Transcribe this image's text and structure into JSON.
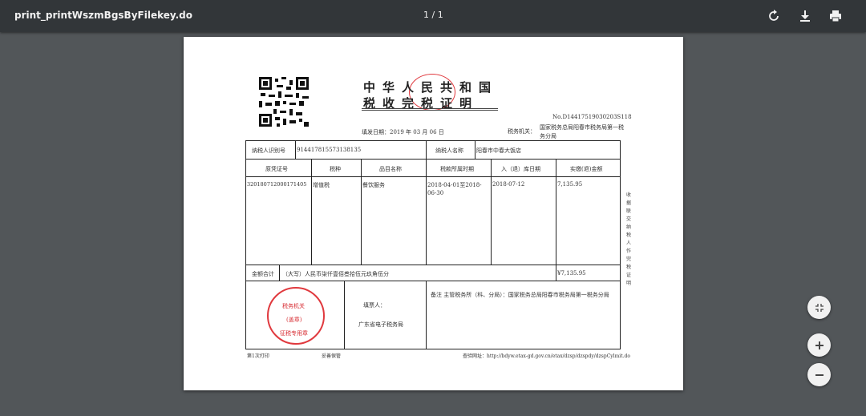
{
  "toolbar": {
    "title": "print_printWszmBgsByFilekey.do",
    "page_indicator": "1 / 1",
    "rotate_icon": "rotate-icon",
    "download_icon": "download-icon",
    "print_icon": "print-icon"
  },
  "document": {
    "title_line1": "中华人民共和国",
    "title_line2": "税收完税证明",
    "ticket_no": "No.D14417519030203S118",
    "fill_date": "填发日期：2019 年 03 月 06 日",
    "tax_office_label": "税务机关：",
    "tax_office_value": "国家税务总局阳春市税务局第一税务分局",
    "taxpayer_id_label": "纳税人识别号",
    "taxpayer_id": "914417815573138135",
    "taxpayer_name_label": "纳税人名称",
    "taxpayer_name": "阳春市中春大饭店",
    "headers": [
      "原凭证号",
      "税种",
      "品目名称",
      "税款所属时期",
      "入（退）库日期",
      "实缴(退)金额"
    ],
    "row": {
      "voucher": "320180712000171405",
      "tax_type": "增值税",
      "item": "餐饮服务",
      "period": "2018-04-01至2018-06-30",
      "date": "2018-07-12",
      "amount": "7,135.95"
    },
    "total_label": "金额合计",
    "total_words": "（大写）人民币柒仟壹佰叁拾伍元玖角伍分",
    "total_amount": "¥7,135.95",
    "stamp_mid": "税务机关",
    "stamp_ink": "(盖章)",
    "stamp_bottom": "征税专用章",
    "filler_label": "填票人：",
    "filler_value": "广东省电子税务局",
    "remark": "备注  主管税务所（科、分局）：国家税务总局阳春市税务局第一税务分局",
    "side_note": "收据联 交纳税人作完税证明",
    "footer_left": "第1次打印",
    "footer_mid": "妥善保管",
    "footer_right": "查验网址：http://bdyw.etax-gd.gov.cn/etax/dzsp/dzspdy/dzspCylmit.do"
  },
  "zoom": {
    "fit_icon": "fit-page-icon",
    "zoom_in_icon": "zoom-in-icon",
    "zoom_out_icon": "zoom-out-icon"
  },
  "colors": {
    "toolbar_bg": "#323639",
    "viewer_bg": "#525659",
    "stamp_red": "#e0393e"
  }
}
